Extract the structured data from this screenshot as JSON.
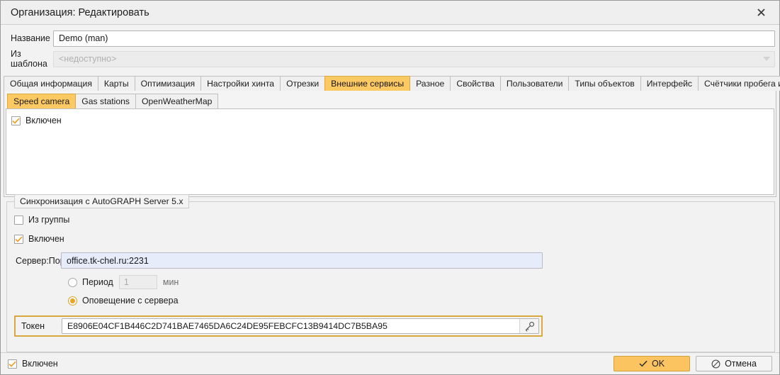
{
  "window": {
    "title": "Организация: Редактировать",
    "close_icon": "close-icon"
  },
  "header_form": {
    "name_label": "Название",
    "name_value": "Demo (man)",
    "template_label": "Из шаблона",
    "template_value": "<недоступно>"
  },
  "tabs": [
    {
      "label": "Общая информация",
      "active": false
    },
    {
      "label": "Карты",
      "active": false
    },
    {
      "label": "Оптимизация",
      "active": false
    },
    {
      "label": "Настройки хинта",
      "active": false
    },
    {
      "label": "Отрезки",
      "active": false
    },
    {
      "label": "Внешние сервисы",
      "active": true
    },
    {
      "label": "Разное",
      "active": false
    },
    {
      "label": "Свойства",
      "active": false
    },
    {
      "label": "Пользователи",
      "active": false
    },
    {
      "label": "Типы объектов",
      "active": false
    },
    {
      "label": "Интерфейс",
      "active": false
    },
    {
      "label": "Счётчики пробега и моточасов",
      "active": false
    }
  ],
  "subtabs": [
    {
      "label": "Speed camera",
      "active": true
    },
    {
      "label": "Gas stations",
      "active": false
    },
    {
      "label": "OpenWeatherMap",
      "active": false
    }
  ],
  "panel": {
    "enabled_label": "Включен",
    "enabled_checked": true
  },
  "sync_group": {
    "title": "Синхронизация с AutoGRAPH Server 5.x",
    "from_group_label": "Из группы",
    "from_group_checked": false,
    "enabled_label": "Включен",
    "enabled_checked": true,
    "server_label": "Сервер:Порт",
    "server_value": "office.tk-chel.ru:2231",
    "period_radio_label": "Период",
    "period_value": "1",
    "period_unit": "мин",
    "period_selected": false,
    "notify_radio_label": "Оповещение с сервера",
    "notify_selected": true,
    "token_label": "Токен",
    "token_value": "E8906E04CF1B446C2D741BAE7465DA6C24DE95FEBCFC13B9414DC7B5BA95",
    "key_icon": "key-icon"
  },
  "footer": {
    "enabled_label": "Включен",
    "enabled_checked": true,
    "ok_label": "OK",
    "cancel_label": "Отмена"
  },
  "colors": {
    "accent": "#fcc963",
    "accent_border": "#d9a93d",
    "check_mark": "#e8a22a",
    "field_highlight": "#e6ecf9"
  }
}
